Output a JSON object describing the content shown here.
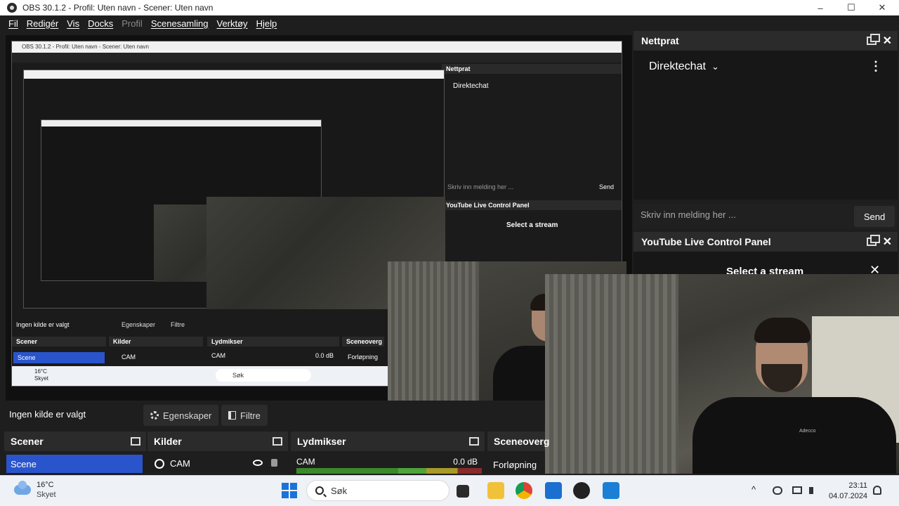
{
  "window": {
    "title": "OBS 30.1.2 - Profil: Uten navn - Scener: Uten navn",
    "min_glyph": "–",
    "max_glyph": "☐",
    "close_glyph": "✕"
  },
  "menu": {
    "items": [
      "Fil",
      "Redigér",
      "Vis",
      "Docks",
      "Profil",
      "Scenesamling",
      "Verktøy",
      "Hjelp"
    ],
    "disabled_index": 4
  },
  "nested_preview": {
    "chat_title": "Nettprat",
    "chat_mode": "Direktechat",
    "chat_placeholder": "Skriv inn melding her ...",
    "send": "Send",
    "yt_title": "YouTube Live Control Panel",
    "select_stream": "Select a stream",
    "no_source": "Ingen kilde er valgt",
    "properties": "Egenskaper",
    "filters": "Filtre",
    "scenes": "Scener",
    "sources": "Kilder",
    "mixer": "Lydmikser",
    "transitions": "Sceneoverg",
    "scene_item": "Scene",
    "source_item": "CAM",
    "transition_item": "Forløpning",
    "db": "0.0 dB",
    "search": "Søk",
    "temp": "16°C",
    "cond": "Skyet"
  },
  "chat_dock": {
    "title": "Nettprat",
    "mode": "Direktechat",
    "input_placeholder": "Skriv inn melding her ...",
    "send_label": "Send"
  },
  "yt_dock": {
    "title": "YouTube Live Control Panel",
    "select_stream": "Select a stream"
  },
  "controls": {
    "no_source": "Ingen kilde er valgt",
    "properties": "Egenskaper",
    "filters": "Filtre"
  },
  "panels": {
    "scenes": {
      "title": "Scener",
      "items": [
        "Scene"
      ]
    },
    "sources": {
      "title": "Kilder",
      "items": [
        "CAM"
      ]
    },
    "mixer": {
      "title": "Lydmikser",
      "channel": "CAM",
      "level": "0.0 dB"
    },
    "transitions": {
      "title": "Sceneoverg",
      "value": "Forløpning"
    }
  },
  "taskbar": {
    "weather_temp": "16°C",
    "weather_cond": "Skyet",
    "search_label": "Søk",
    "time": "23:11",
    "date": "04.07.2024",
    "tray_chevron": "^",
    "apps": [
      "file-explorer",
      "chrome",
      "store",
      "obs",
      "vscode"
    ]
  },
  "colors": {
    "accent": "#2a54cc",
    "panel_bg": "#1e1e1e",
    "dock_head": "#2b2b2b"
  },
  "camera_label": "Adecco"
}
